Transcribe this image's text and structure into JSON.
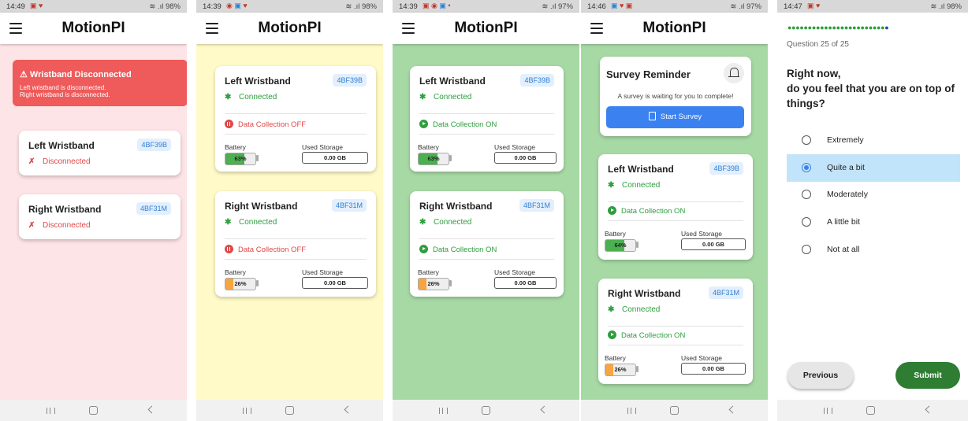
{
  "app_title": "MotionPI",
  "screens": [
    {
      "time": "14:49",
      "status_right": "≋ .ıl 98%",
      "alert": {
        "title": "⚠ Wristband Disconnected",
        "line1": "Left wristband is disconnected.",
        "line2": "Right wristband is disconnected."
      },
      "left": {
        "title": "Left Wristband",
        "id": "4BF39B",
        "status": "Disconnected"
      },
      "right": {
        "title": "Right Wristband",
        "id": "4BF31M",
        "status": "Disconnected"
      },
      "background": "#fde4e6"
    },
    {
      "time": "14:39",
      "status_right": "≋ .ıl 98%",
      "left": {
        "title": "Left Wristband",
        "id": "4BF39B",
        "status": "Connected",
        "data_collection": "Data Collection OFF",
        "battery_label": "Battery",
        "battery_pct": "63%",
        "battery_level": 0.63,
        "battery_color": "#4caf50",
        "storage_label": "Used Storage",
        "storage": "0.00 GB"
      },
      "right": {
        "title": "Right Wristband",
        "id": "4BF31M",
        "status": "Connected",
        "data_collection": "Data Collection OFF",
        "battery_label": "Battery",
        "battery_pct": "26%",
        "battery_level": 0.26,
        "battery_color": "#f7a541",
        "storage_label": "Used Storage",
        "storage": "0.00 GB"
      },
      "background": "#fffac7"
    },
    {
      "time": "14:39",
      "status_right": "≋ .ıl 97%",
      "left": {
        "title": "Left Wristband",
        "id": "4BF39B",
        "status": "Connected",
        "data_collection": "Data Collection ON",
        "battery_label": "Battery",
        "battery_pct": "63%",
        "battery_level": 0.63,
        "battery_color": "#4caf50",
        "storage_label": "Used Storage",
        "storage": "0.00 GB"
      },
      "right": {
        "title": "Right Wristband",
        "id": "4BF31M",
        "status": "Connected",
        "data_collection": "Data Collection ON",
        "battery_label": "Battery",
        "battery_pct": "26%",
        "battery_level": 0.26,
        "battery_color": "#f7a541",
        "storage_label": "Used Storage",
        "storage": "0.00 GB"
      },
      "background": "#a7d9a5"
    },
    {
      "time": "14:46",
      "status_right": "≋ .ıl 97%",
      "survey": {
        "title": "Survey Reminder",
        "message": "A survey is waiting for you to complete!",
        "button": "Start Survey"
      },
      "left": {
        "title": "Left Wristband",
        "id": "4BF39B",
        "status": "Connected",
        "data_collection": "Data Collection ON",
        "battery_label": "Battery",
        "battery_pct": "64%",
        "battery_level": 0.64,
        "battery_color": "#4caf50",
        "storage_label": "Used Storage",
        "storage": "0.00 GB"
      },
      "right": {
        "title": "Right Wristband",
        "id": "4BF31M",
        "status": "Connected",
        "data_collection": "Data Collection ON",
        "battery_label": "Battery",
        "battery_pct": "26%",
        "battery_level": 0.26,
        "battery_color": "#f7a541",
        "storage_label": "Used Storage",
        "storage": "0.00 GB"
      },
      "background": "#a7d9a5"
    },
    {
      "time": "14:47",
      "status_right": "≋ .ıl 98%",
      "progress_dots": "●●●●●●●●●●●●●●●●●●●●●●●●",
      "progress_last": "●",
      "question_count": "Question 25 of 25",
      "question_line1": "Right now,",
      "question_line2": "do you feel that you are on top of things?",
      "options": [
        "Extremely",
        "Quite a bit",
        "Moderately",
        "A little bit",
        "Not at all"
      ],
      "selected": "Quite a bit",
      "prev_button": "Previous",
      "submit_button": "Submit"
    }
  ],
  "icons": {
    "menu": "hamburger-icon",
    "bluetooth_on": "bluetooth-connected-icon",
    "bluetooth_off": "bluetooth-disabled-icon",
    "bell": "bell-icon",
    "clipboard": "clipboard-icon"
  },
  "colors": {
    "connected": "#2e9e3e",
    "disconnected": "#e04848",
    "accent": "#3b82f0",
    "submit": "#2e7d32"
  }
}
